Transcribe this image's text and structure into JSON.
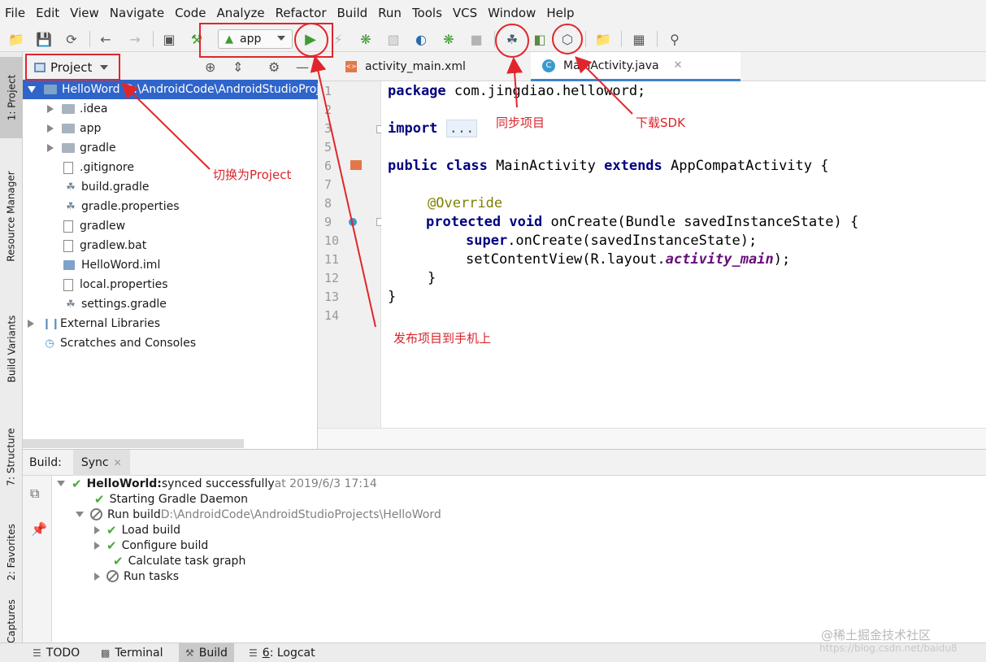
{
  "menu": [
    "File",
    "Edit",
    "View",
    "Navigate",
    "Code",
    "Analyze",
    "Refactor",
    "Build",
    "Run",
    "Tools",
    "VCS",
    "Window",
    "Help"
  ],
  "toolbar": {
    "run_config": "app"
  },
  "left_strip": {
    "tabs": [
      "1: Project",
      "Resource Manager",
      "Build Variants",
      "7: Structure",
      "2: Favorites",
      "Captures"
    ]
  },
  "project": {
    "title": "Project",
    "root_name": "HelloWord",
    "root_path": "D:\\AndroidCode\\AndroidStudioProjects\\HelloWord",
    "items": [
      {
        "label": ".idea",
        "kind": "folder"
      },
      {
        "label": "app",
        "kind": "folder"
      },
      {
        "label": "gradle",
        "kind": "folder"
      },
      {
        "label": ".gitignore",
        "kind": "file"
      },
      {
        "label": "build.gradle",
        "kind": "gradle"
      },
      {
        "label": "gradle.properties",
        "kind": "gradle"
      },
      {
        "label": "gradlew",
        "kind": "file"
      },
      {
        "label": "gradlew.bat",
        "kind": "file"
      },
      {
        "label": "HelloWord.iml",
        "kind": "module"
      },
      {
        "label": "local.properties",
        "kind": "file"
      },
      {
        "label": "settings.gradle",
        "kind": "gradle"
      }
    ],
    "external_libraries": "External Libraries",
    "scratches": "Scratches and Consoles"
  },
  "editor": {
    "tabs": [
      {
        "label": "activity_main.xml"
      },
      {
        "label": "MainActivity.java"
      }
    ],
    "line_numbers": [
      "1",
      "2",
      "3",
      "5",
      "6",
      "7",
      "8",
      "9",
      "10",
      "11",
      "12",
      "13",
      "14"
    ],
    "code": {
      "l1_kw": "package",
      "l1_rest": " com.jingdiao.helloword;",
      "l3_kw": "import",
      "l3_fold": "...",
      "l6_kw1": "public class",
      "l6_mid": " MainActivity ",
      "l6_kw2": "extends",
      "l6_rest": " AppCompatActivity {",
      "l8_anno": "@Override",
      "l9_kw": "protected void",
      "l9_rest": " onCreate(Bundle savedInstanceState) {",
      "l10_kw": "super",
      "l10_rest": ".onCreate(savedInstanceState);",
      "l11_pre": "setContentView(R.layout.",
      "l11_field": "activity_main",
      "l11_post": ");",
      "l12": "}",
      "l13": "}"
    }
  },
  "build": {
    "label": "Build:",
    "tab": "Sync",
    "rows": {
      "synced_bold": "HelloWorld:",
      "synced_text": " synced successfully",
      "synced_time": " at 2019/6/3 17:14",
      "daemon": "Starting Gradle Daemon",
      "run_build": "Run build",
      "run_build_path": " D:\\AndroidCode\\AndroidStudioProjects\\HelloWord",
      "load_build": "Load build",
      "configure_build": "Configure build",
      "task_graph": "Calculate task graph",
      "run_tasks": "Run tasks"
    }
  },
  "statusbar": {
    "todo": "TODO",
    "terminal": "Terminal",
    "build": "Build",
    "logcat_num": "6",
    "logcat_text": ": Logcat"
  },
  "annotations": {
    "switch_project": "切换为Project",
    "sync_project": "同步项目",
    "download_sdk": "下载SDK",
    "deploy_phone": "发布项目到手机上"
  },
  "watermark": "@稀土掘金技术社区",
  "watermark2": "https://blog.csdn.net/baidu8"
}
